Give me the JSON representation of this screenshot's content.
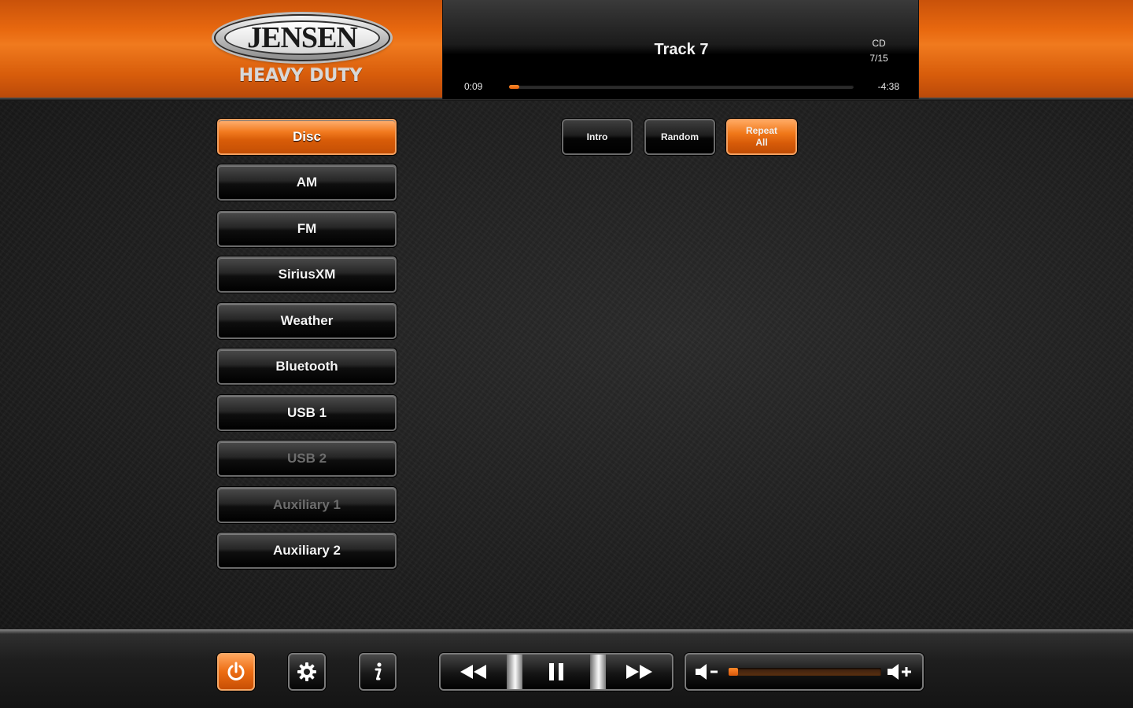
{
  "header": {
    "brand": "JENSEN",
    "brand_sub": "HEAVY DUTY"
  },
  "now_playing": {
    "track": "Track 7",
    "source": "CD",
    "track_position": "7/15",
    "elapsed": "0:09",
    "remaining": "-4:38",
    "progress_fraction": 0.03
  },
  "sources": [
    {
      "label": "Disc",
      "state": "active"
    },
    {
      "label": "AM",
      "state": "normal"
    },
    {
      "label": "FM",
      "state": "normal"
    },
    {
      "label": "SiriusXM",
      "state": "normal"
    },
    {
      "label": "Weather",
      "state": "normal"
    },
    {
      "label": "Bluetooth",
      "state": "normal"
    },
    {
      "label": "USB 1",
      "state": "normal"
    },
    {
      "label": "USB 2",
      "state": "disabled"
    },
    {
      "label": "Auxiliary 1",
      "state": "disabled"
    },
    {
      "label": "Auxiliary 2",
      "state": "normal"
    }
  ],
  "modes": {
    "intro": "Intro",
    "random": "Random",
    "repeat_line1": "Repeat",
    "repeat_line2": "All",
    "active": "repeat"
  },
  "bottom": {
    "power_icon": "power-icon",
    "settings_icon": "gear-icon",
    "info_icon": "info-icon",
    "rewind_icon": "rewind-icon",
    "pause_icon": "pause-icon",
    "fast_forward_icon": "fast-forward-icon",
    "volume_down_icon": "volume-down-icon",
    "volume_up_icon": "volume-up-icon",
    "volume_level_fraction": 0.06
  },
  "colors": {
    "accent": "#e8680f",
    "disabled_text": "#6c6c6c"
  }
}
